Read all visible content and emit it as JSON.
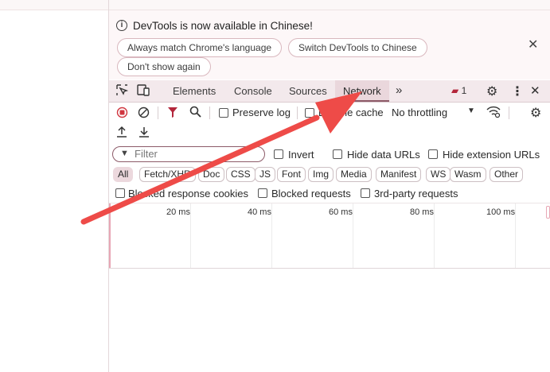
{
  "infobar": {
    "message": "DevTools is now available in Chinese!",
    "buttons": [
      "Always match Chrome's language",
      "Switch DevTools to Chinese",
      "Don't show again"
    ]
  },
  "tabs": [
    "Elements",
    "Console",
    "Sources",
    "Network"
  ],
  "active_tab": "Network",
  "issues_count": "1",
  "toolbar": {
    "preserve_log": "Preserve log",
    "disable_cache": "Disable cache",
    "throttling": "No throttling"
  },
  "filter": {
    "placeholder": "Filter",
    "invert": "Invert",
    "hide_data_urls": "Hide data URLs",
    "hide_extension_urls": "Hide extension URLs"
  },
  "type_filters": [
    "All",
    "Fetch/XHR",
    "Doc",
    "CSS",
    "JS",
    "Font",
    "Img",
    "Media",
    "Manifest",
    "WS",
    "Wasm",
    "Other"
  ],
  "request_filters": {
    "blocked_cookies": "Blocked response cookies",
    "blocked_requests": "Blocked requests",
    "third_party": "3rd-party requests"
  },
  "timeline_ticks": [
    "20 ms",
    "40 ms",
    "60 ms",
    "80 ms",
    "100 ms"
  ],
  "icons": {
    "inspect": "cursor-select-icon",
    "device": "device-toolbar-icon",
    "more_tabs": "chevron-double-right-icon",
    "settings": "gear-icon",
    "menu": "kebab-menu-icon",
    "close": "close-icon"
  },
  "colors": {
    "accent": "#8d5a68",
    "record": "#d0363f",
    "arrow": "#ee4b48"
  }
}
